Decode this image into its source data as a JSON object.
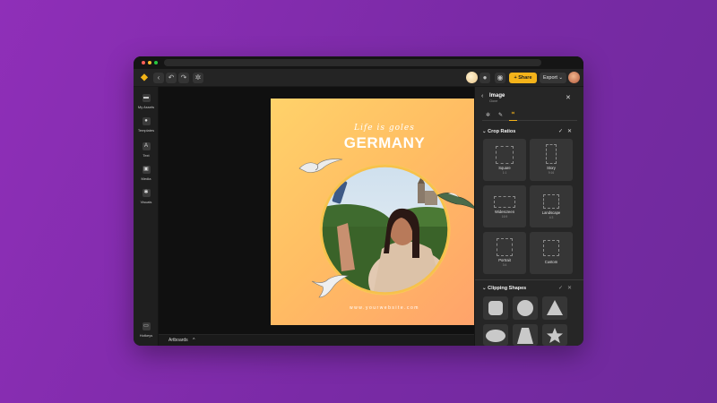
{
  "app": {
    "share_label": "Share",
    "export_label": "Export",
    "bottom_label": "Artboards",
    "bottom_chevron": "^"
  },
  "sidebar": {
    "items": [
      {
        "label": "My Assets",
        "icon": "folder-icon"
      },
      {
        "label": "Templates",
        "icon": "templates-icon"
      },
      {
        "label": "Text",
        "icon": "text-icon",
        "glyph": "A"
      },
      {
        "label": "Media",
        "icon": "media-icon"
      },
      {
        "label": "Visuals",
        "icon": "visuals-icon"
      },
      {
        "label": "Hotkeys",
        "icon": "keyboard-icon"
      }
    ]
  },
  "artboard": {
    "tagline": "Life is goles",
    "headline": "GERMANY",
    "website": "www.yourwebsite.com"
  },
  "panel": {
    "title": "Image",
    "subtitle": "Clone",
    "crop_header": "Crop Ratios",
    "clip_header": "Clipping Shapes",
    "crop_ratios": [
      {
        "label": "Square",
        "ratio": "1:1"
      },
      {
        "label": "Story",
        "ratio": "9:16"
      },
      {
        "label": "Widescreen",
        "ratio": "16:9"
      },
      {
        "label": "Landscape",
        "ratio": "4:3"
      },
      {
        "label": "Portrait",
        "ratio": "3:4"
      },
      {
        "label": "Custom",
        "ratio": ""
      }
    ],
    "clipping_shapes": [
      "rounded-square",
      "circle",
      "triangle",
      "ellipse",
      "trapezoid",
      "star"
    ]
  },
  "colors": {
    "accent": "#f4b31a",
    "background": "#8f2fb8",
    "artboard_start": "#ffd26a",
    "artboard_end": "#ffa06c"
  }
}
